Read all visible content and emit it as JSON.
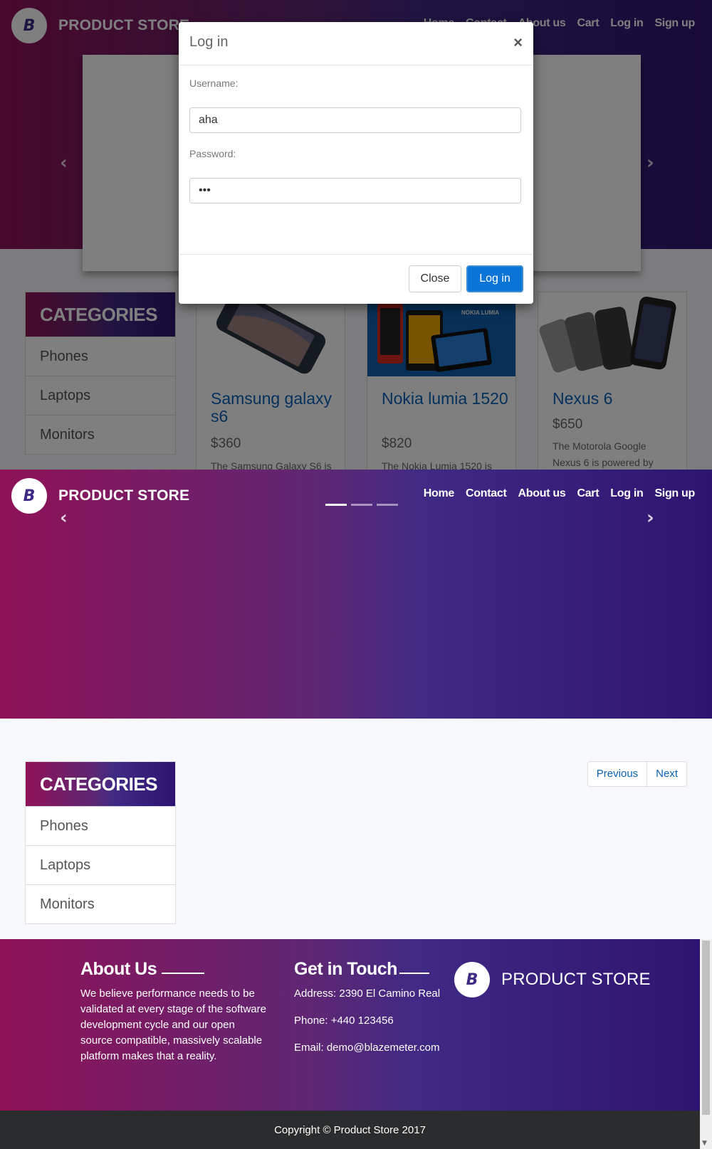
{
  "brand": {
    "name": "PRODUCT STORE",
    "logo_letter": "B"
  },
  "nav": {
    "items": [
      "Home",
      "Contact",
      "About us",
      "Cart",
      "Log in",
      "Sign up"
    ]
  },
  "categories": {
    "title": "CATEGORIES",
    "items": [
      "Phones",
      "Laptops",
      "Monitors"
    ]
  },
  "products": [
    {
      "name": "Samsung galaxy s6",
      "price": "$360",
      "desc": "The Samsung Galaxy S6 is"
    },
    {
      "name": "Nokia lumia 1520",
      "price": "$820",
      "desc": "The Nokia Lumia 1520 is",
      "image_text": "NOKIA LUMIA"
    },
    {
      "name": "Nexus 6",
      "price": "$650",
      "desc": "The Motorola Google Nexus 6 is powered by"
    }
  ],
  "login_modal": {
    "title": "Log in",
    "close_symbol": "×",
    "username_label": "Username:",
    "username_value": "aha",
    "password_label": "Password:",
    "password_value": "•••",
    "close_button": "Close",
    "login_button": "Log in"
  },
  "pagination": {
    "previous": "Previous",
    "next": "Next"
  },
  "footer": {
    "about_title": "About Us",
    "about_text": "We believe performance needs to be validated at every stage of the software development cycle and our open source compatible, massively scalable platform makes that a reality.",
    "contact_title": "Get in Touch",
    "address": "Address: 2390 El Camino Real",
    "phone": "Phone: +440 123456",
    "email": "Email: demo@blazemeter.com",
    "brand": "PRODUCT STORE",
    "copyright": "Copyright © Product Store 2017"
  },
  "colors": {
    "gradient_start": "#8f1257",
    "gradient_end": "#2d1470",
    "link": "#0a63b8",
    "primary_button": "#0b75d7",
    "footer_bar": "#2b2c2e"
  },
  "icons": {
    "prev": "chevron-left-icon",
    "next": "chevron-right-icon",
    "close": "close-icon"
  }
}
